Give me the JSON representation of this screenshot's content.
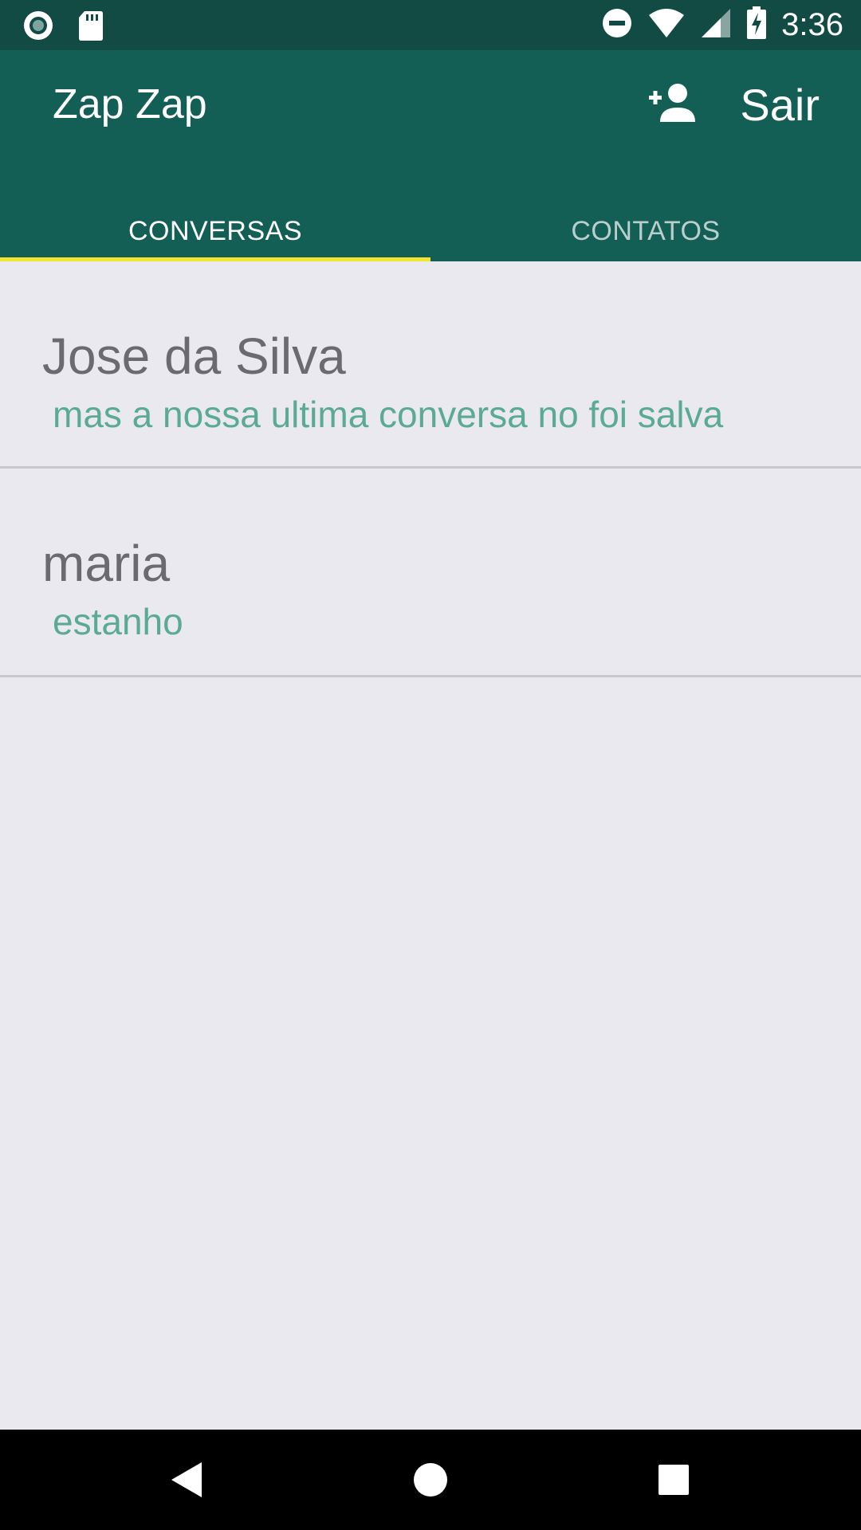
{
  "status_bar": {
    "time": "3:36",
    "left_icons": [
      "record-icon",
      "sd-card-icon"
    ],
    "right_icons": [
      "do-not-disturb-icon",
      "wifi-icon",
      "cell-signal-icon",
      "battery-charging-icon"
    ]
  },
  "app_bar": {
    "title": "Zap Zap",
    "add_contact_icon": "person-add-icon",
    "sair_label": "Sair"
  },
  "tabs": [
    {
      "label": "CONVERSAS",
      "active": true
    },
    {
      "label": "CONTATOS",
      "active": false
    }
  ],
  "conversations": [
    {
      "name": "Jose da Silva",
      "last_message": "mas a nossa ultima conversa no foi salva"
    },
    {
      "name": "maria",
      "last_message": "estanho"
    }
  ],
  "colors": {
    "status_bar": "#124B44",
    "app_bar": "#135E55",
    "tab_indicator": "#F2E530",
    "name_text": "#6A6A6F",
    "message_text": "#5AAA95",
    "background": "#EAE9EF"
  },
  "nav_bar": {
    "icons": [
      "back-icon",
      "home-icon",
      "recents-icon"
    ]
  }
}
